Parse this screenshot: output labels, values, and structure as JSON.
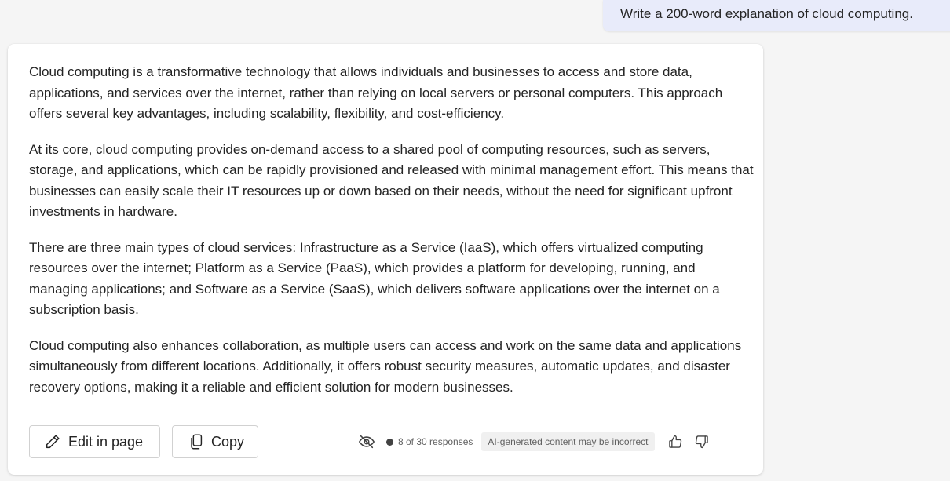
{
  "user_prompt": "Write a 200-word explanation of cloud computing.",
  "response": {
    "paragraphs": [
      "Cloud computing is a transformative technology that allows individuals and businesses to access and store data, applications, and services over the internet, rather than relying on local servers or personal computers. This approach offers several key advantages, including scalability, flexibility, and cost-efficiency.",
      "At its core, cloud computing provides on-demand access to a shared pool of computing resources, such as servers, storage, and applications, which can be rapidly provisioned and released with minimal management effort. This means that businesses can easily scale their IT resources up or down based on their needs, without the need for significant upfront investments in hardware.",
      "There are three main types of cloud services: Infrastructure as a Service (IaaS), which offers virtualized computing resources over the internet; Platform as a Service (PaaS), which provides a platform for developing, running, and managing applications; and Software as a Service (SaaS), which delivers software applications over the internet on a subscription basis.",
      "Cloud computing also enhances collaboration, as multiple users can access and work on the same data and applications simultaneously from different locations. Additionally, it offers robust security measures, automatic updates, and disaster recovery options, making it a reliable and efficient solution for modern businesses."
    ]
  },
  "actions": {
    "edit_label": "Edit in page",
    "copy_label": "Copy"
  },
  "footer": {
    "response_count": "8 of 30 responses",
    "ai_notice": "AI-generated content may be incorrect"
  },
  "icons": {
    "edit": "pencil-icon",
    "copy": "copy-icon",
    "visibility": "eye-off-icon",
    "like": "thumbs-up-icon",
    "dislike": "thumbs-down-icon"
  }
}
